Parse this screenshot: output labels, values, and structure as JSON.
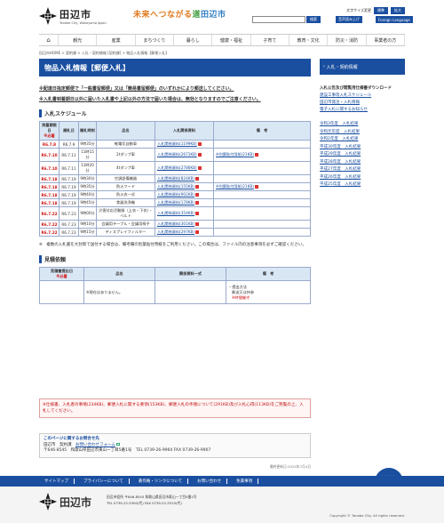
{
  "header": {
    "city_name": "田辺市",
    "city_name_en": "Tanabe City, Wakayama Japan",
    "slogan_a": "未来へつながる",
    "slogan_b": "道",
    "slogan_c": "田辺市",
    "links": [
      "文字サイズ変更",
      "標準",
      "拡大"
    ],
    "search_button": "検索",
    "lang_button_1": "音声読み上げ",
    "lang_button_2": "Foreign Language"
  },
  "nav": {
    "home": "⌂",
    "items": [
      "観光",
      "産業",
      "まちづくり",
      "暮らし",
      "健康・福祉",
      "子育て",
      "教育・文化",
      "防災・消防",
      "事業者の方"
    ]
  },
  "breadcrumb": "田辺市HOME > 契約課 > 入札・契約情報 [契約課] > 物品入札情報【郵便入札】",
  "main": {
    "title": "物品入札情報【郵便入札】",
    "notice1": "※配達日指定郵便で「一般書留郵便」又は「簡易書留郵便」のいずれかにより郵送してください。",
    "notice2": "※入札書到着期日以外に届いた入札書や上記以外の方法で届いた場合は、無効となりますのでご注意ください。",
    "schedule_title": "入札スケジュール",
    "table_headers": [
      "到着期限日",
      "開札日",
      "開札時刻",
      "品名",
      "入札関係資料",
      "備　考"
    ],
    "req_label": "※必着",
    "rows": [
      {
        "deadline": "R6.7.8",
        "open": "R6.7.9",
        "time": "9時35分",
        "item": "軽電気自動車",
        "doc": "入札関係資料(1199KB)",
        "note": ""
      },
      {
        "deadline": "R6.7.10",
        "open": "R6.7.11",
        "time": "11時15分",
        "item": "2tダンプ車",
        "doc": "入札関係資料(2671KB)",
        "note": "※別葉貼付用紙(21KB)"
      },
      {
        "deadline": "R6.7.10",
        "open": "R6.7.11",
        "time": "11時20分",
        "item": "4tダンプ車",
        "doc": "入札関係資料(2786KB)",
        "note": ""
      },
      {
        "deadline": "R6.7.18",
        "open": "R6.7.19",
        "time": "9時30分",
        "item": "空調設備機器",
        "doc": "入札関係資料(824KB)",
        "note": ""
      },
      {
        "deadline": "R6.7.18",
        "open": "R6.7.19",
        "time": "9時35分",
        "item": "防火フード",
        "doc": "入札関係資料(155KB)",
        "note": "※別葉貼付用紙(21KB)"
      },
      {
        "deadline": "R6.7.18",
        "open": "R6.7.19",
        "time": "9時40分",
        "item": "防火衣一式",
        "doc": "入札関係資料(902KB)",
        "note": ""
      },
      {
        "deadline": "R6.7.18",
        "open": "R6.7.19",
        "time": "9時45分",
        "item": "食器洗浄機",
        "doc": "入札関係資料(178KB)",
        "note": ""
      },
      {
        "deadline": "R6.7.22",
        "open": "R6.7.23",
        "time": "9時00分",
        "item": "災害対応活動服（上衣・下衣）・ベルト",
        "doc": "入札関係資料(354KB)",
        "note": ""
      },
      {
        "deadline": "R6.7.22",
        "open": "R6.7.23",
        "time": "9時10分",
        "item": "会議用テーブル・会議用椅子",
        "doc": "入札関係資料(301KB)",
        "note": ""
      },
      {
        "deadline": "R6.7.22",
        "open": "R6.7.23",
        "time": "9時15分",
        "item": "ディスプレイフィルター",
        "doc": "入札関係資料(297KB)",
        "note": ""
      }
    ],
    "note_text": "※　複数の入札書を大封筒で送付する場合は、備考欄の別葉貼付用紙をご利用ください。この場合は、ファイル内の注意事項を必ずご確認ください。",
    "quote_title": "見積依頼",
    "quote_headers": [
      "見積書提出日",
      "品名",
      "関係資料一式",
      "備　考"
    ],
    "quote_req": "※必着",
    "quote_empty": "※現在はありません。",
    "quote_note_1": "・提出方法",
    "quote_note_2": "郵送又は持参",
    "quote_note_3": "※時間厳守",
    "warn_text": "※仕様書、入札者の事情(234KB)、郵便入札に関する要領(153KB)、郵便入札の手順について(291KB)及び入札心得(113KB)をご熟覧の上、入札してください。",
    "contact_title": "このページに関するお問合せ先",
    "contact_dept": "田辺市　契約課",
    "contact_form": "お問い合わせフォーム",
    "contact_addr": "〒646-8545　和歌山県田辺市東山一丁目5番1号　TEL 0739-26-9964 FAX 0739-26-9907",
    "updated": "最終更新日:2024年7月4日"
  },
  "sidebar": {
    "head": "入札・契約情報",
    "list_title": "入札公告及び閲覧用仕様書ダウンロード",
    "links": [
      "建設工事等入札スケジュール",
      "田辺市発注・入札情報",
      "電子入札に関するお知らせ"
    ],
    "years": [
      "令和3年度　入札結果",
      "令和元年度　入札結果",
      "令和2年度　入札結果",
      "平成30年度　入札結果",
      "平成29年度　入札結果",
      "平成28年度　入札結果",
      "平成27年度　入札結果",
      "平成26年度　入札結果",
      "平成25年度　入札結果"
    ]
  },
  "footer": {
    "nav": [
      "サイトマップ",
      "プライバシーについて",
      "著作権・リンクについて",
      "お問い合わせ",
      "免責事項"
    ],
    "totop": "上にもどる",
    "city_name": "田辺市",
    "addr1": "田辺市役所 〒646-8545 和歌山県田辺市東山一丁目5番1号",
    "addr2": "TEL 0739-22-5300(代) FAX 0739-22-5310(代)",
    "copyright": "Copyright © Tanabe City. All rights reserved."
  }
}
